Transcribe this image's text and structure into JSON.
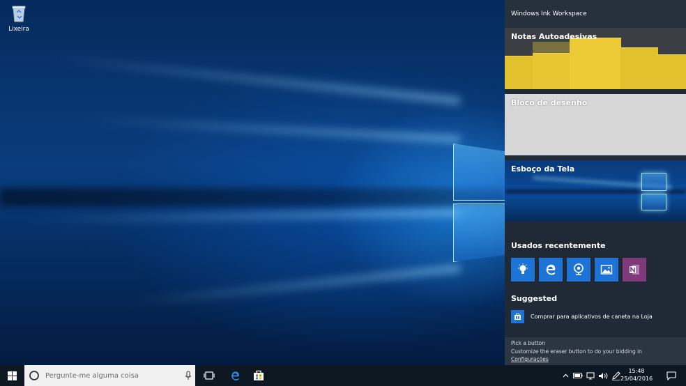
{
  "desktop": {
    "recycle_bin_label": "Lixeira"
  },
  "ink_workspace": {
    "title": "Windows Ink Workspace",
    "tiles": {
      "sticky_notes": "Notas Autoadesivas",
      "sketchpad": "Bloco de desenho",
      "screen_sketch": "Esboço da Tela"
    },
    "recent_title": "Usados recentemente",
    "recent_apps": [
      "lightbulb-app-icon",
      "edge-icon",
      "webcam-app-icon",
      "photos-icon",
      "onenote-icon"
    ],
    "suggested_title": "Suggested",
    "suggested_item": "Comprar para aplicativos de caneta na Loja",
    "footer": {
      "heading": "Pick a button",
      "text": "Customize the eraser button to do your bidding in",
      "link": "Configurações"
    }
  },
  "taskbar": {
    "search_placeholder": "Pergunte-me alguma coisa",
    "time": "15:48",
    "date": "25/04/2016"
  },
  "colors": {
    "accent": "#1e73d6",
    "panel_bg": "#1f2a36",
    "note_yellow": "#e3c02e",
    "onenote_purple": "#80397b",
    "taskbar_bg": "#0e1822"
  }
}
